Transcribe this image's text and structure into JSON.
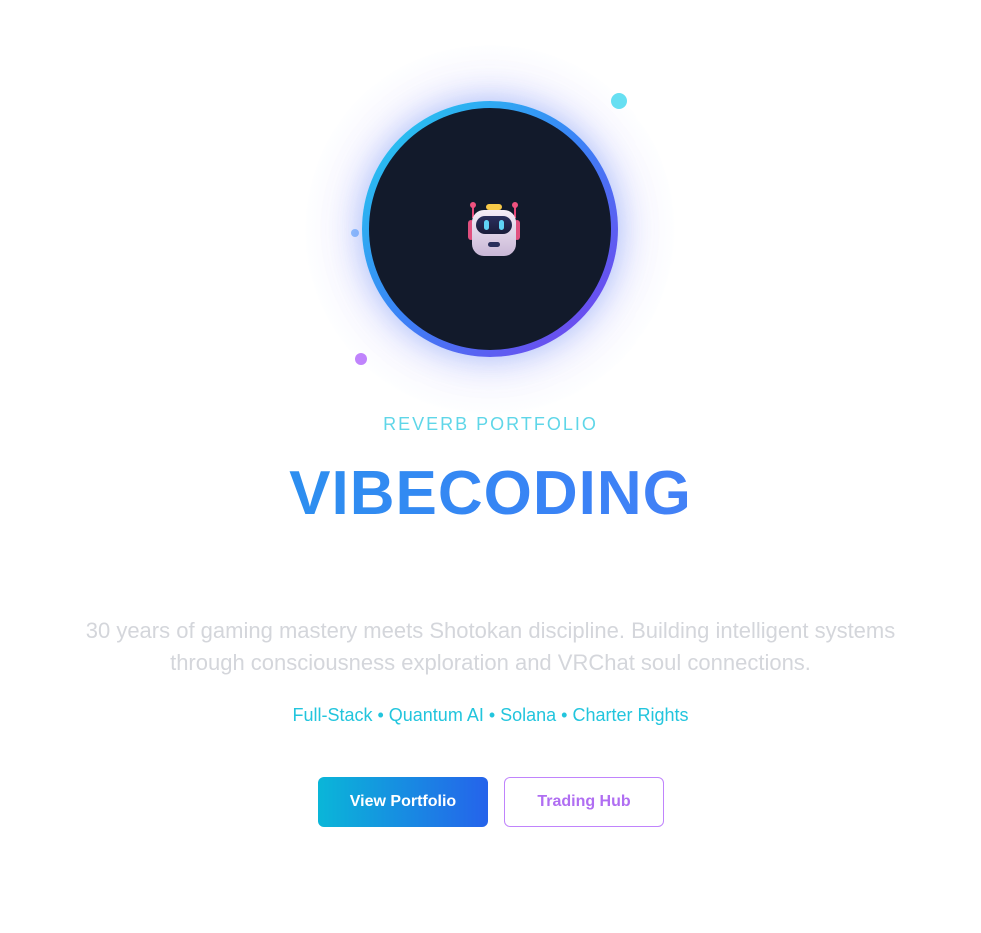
{
  "hero": {
    "avatar_icon": "robot-icon",
    "eyebrow": "REVERB PORTFOLIO",
    "title": "VIBECODING",
    "description_line1": "30 years of gaming mastery meets Shotokan discipline. Building intelligent systems",
    "description_line2": "through consciousness exploration and VRChat soul connections.",
    "tags": "Full-Stack • Quantum AI • Solana • Charter Rights"
  },
  "actions": {
    "primary_label": "View Portfolio",
    "secondary_label": "Trading Hub"
  },
  "colors": {
    "accent_cyan": "#22d3ee",
    "accent_blue": "#3b82f6",
    "accent_purple": "#7c3aed",
    "avatar_bg": "#121a2b"
  }
}
